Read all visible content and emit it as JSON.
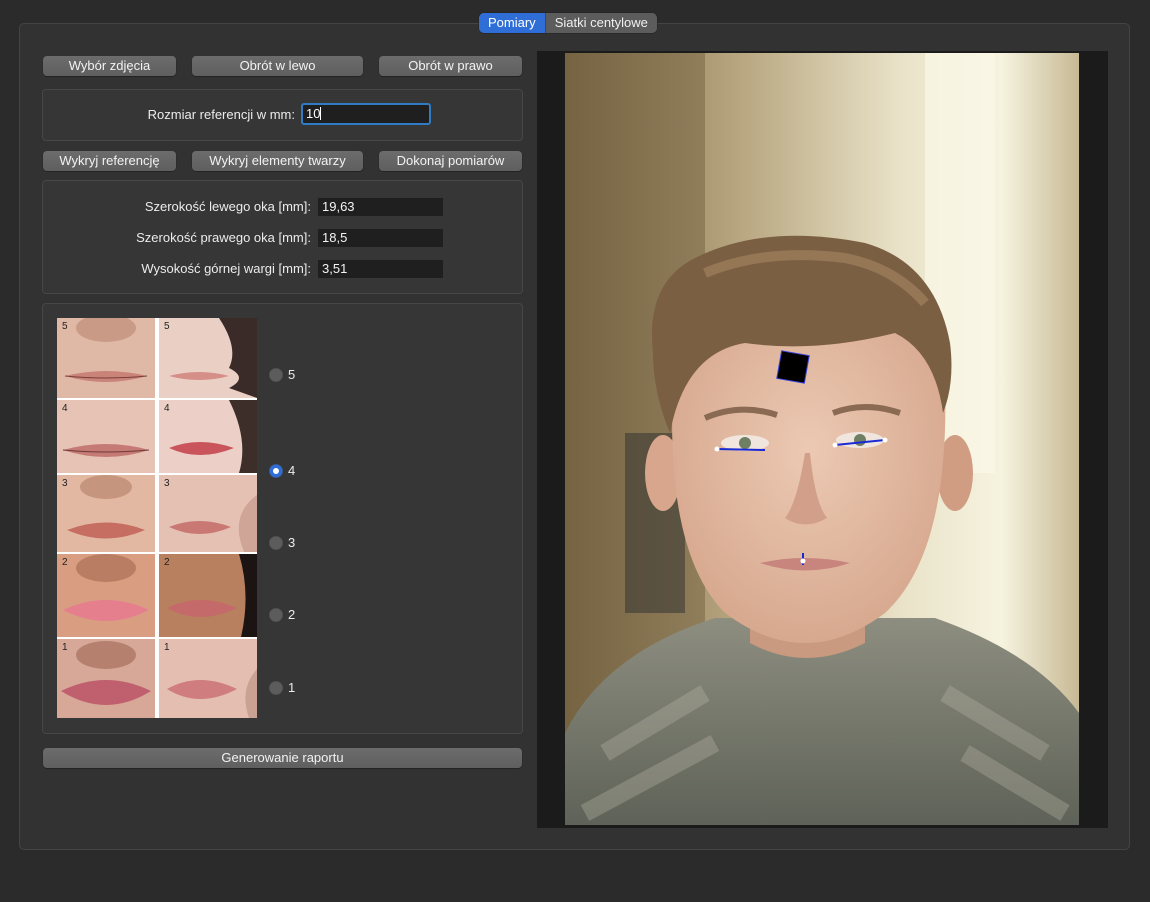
{
  "tabs": [
    {
      "label": "Pomiary",
      "active": true
    },
    {
      "label": "Siatki centylowe",
      "active": false
    }
  ],
  "toolbar": {
    "select_photo": "Wybór zdjęcia",
    "rotate_left": "Obrót w lewo",
    "rotate_right": "Obrót w prawo"
  },
  "reference": {
    "label": "Rozmiar referencji w mm:",
    "value": "10"
  },
  "actions": {
    "detect_reference": "Wykryj referencję",
    "detect_face": "Wykryj elementy twarzy",
    "measure": "Dokonaj pomiarów"
  },
  "measurements": [
    {
      "label": "Szerokość lewego oka [mm]:",
      "value": "19,63"
    },
    {
      "label": "Szerokość prawego oka [mm]:",
      "value": "18,5"
    },
    {
      "label": "Wysokość górnej wargi [mm]:",
      "value": "3,51"
    }
  ],
  "lip_scale": {
    "options": [
      "5",
      "4",
      "3",
      "2",
      "1"
    ],
    "selected": "4",
    "image_numbers": [
      "5",
      "4",
      "3",
      "2",
      "1"
    ]
  },
  "report_button": "Generowanie raportu",
  "colors": {
    "accent": "#2f6ed6",
    "landmark_line": "#1a2bd6",
    "reference_marker": "#000000"
  }
}
